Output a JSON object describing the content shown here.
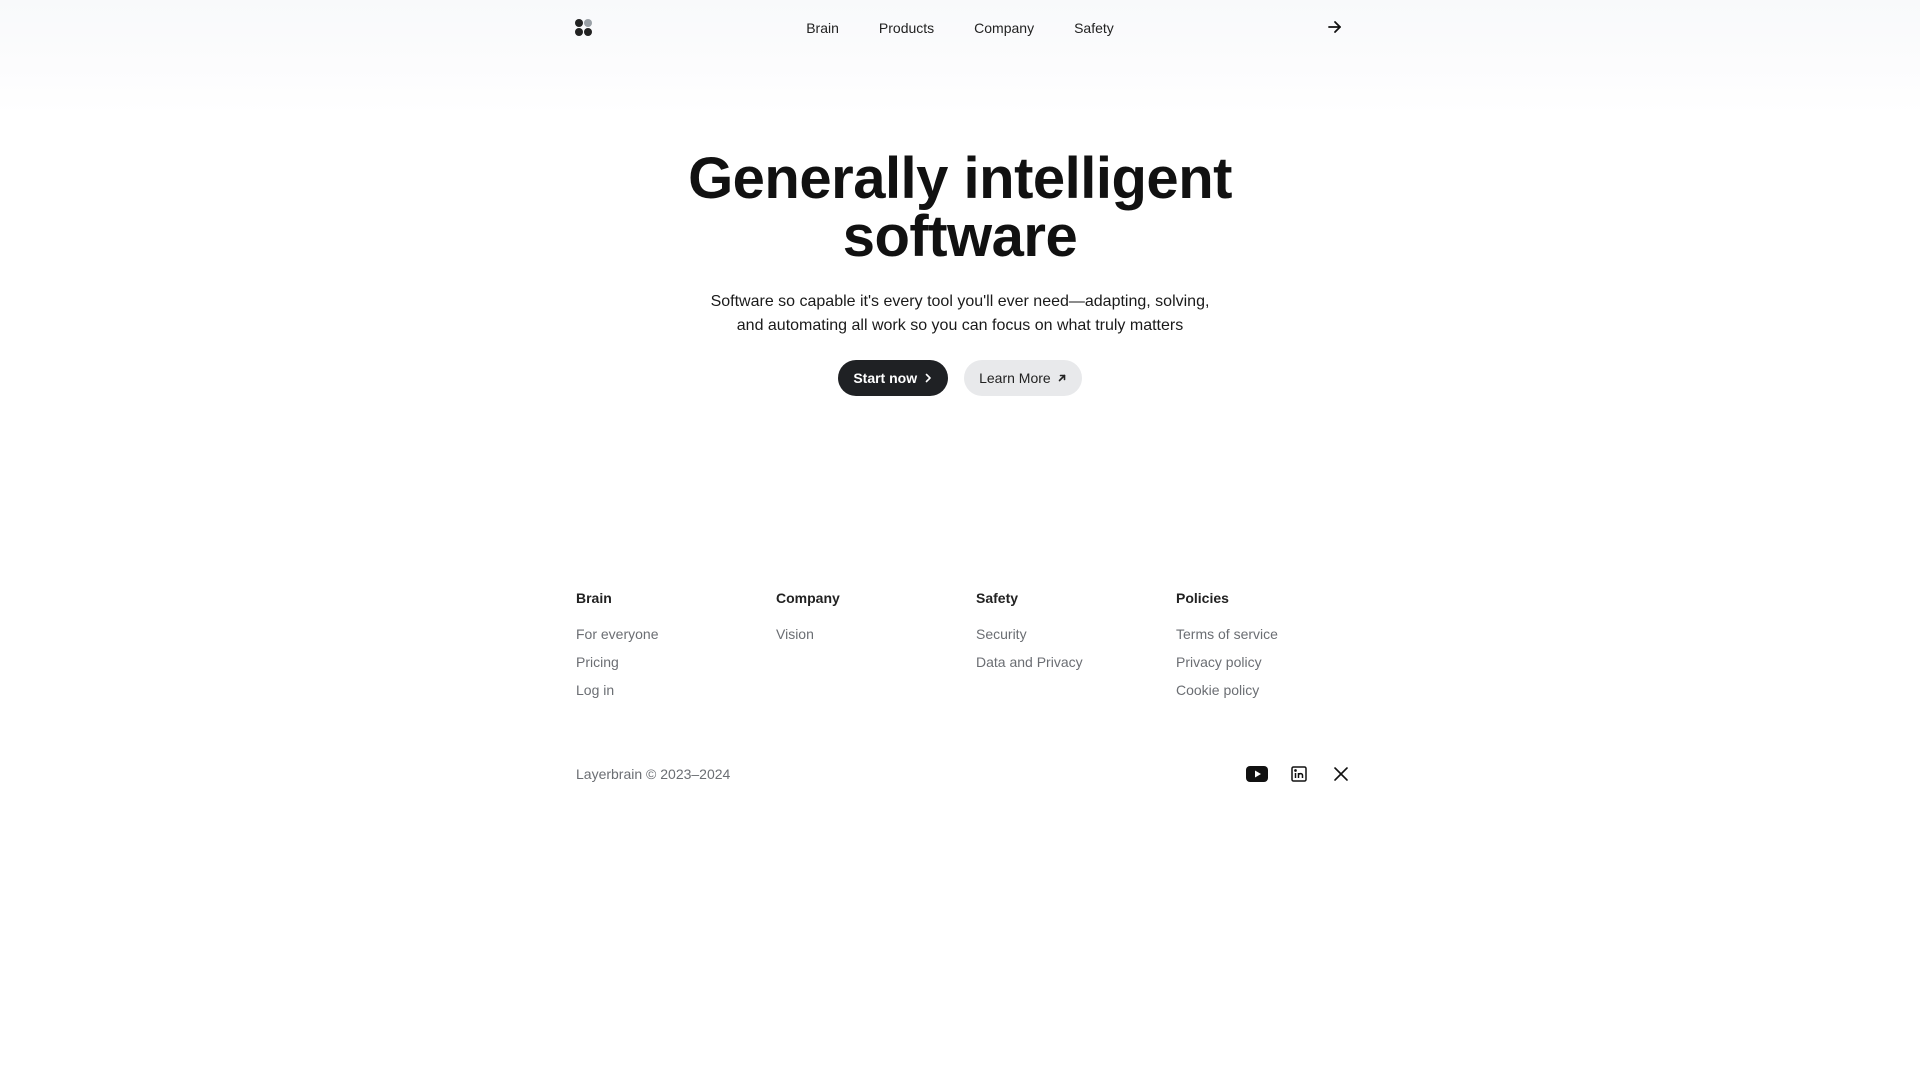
{
  "header": {
    "logo_name": "four-dot-logo",
    "nav": [
      {
        "label": "Brain"
      },
      {
        "label": "Products"
      },
      {
        "label": "Company"
      },
      {
        "label": "Safety"
      }
    ],
    "action_icon": "arrow-right-icon"
  },
  "hero": {
    "title_line1": "Generally intelligent",
    "title_line2": "software",
    "subtitle_line1": "Software so capable it's every tool you'll ever need—adapting, solving,",
    "subtitle_line2": "and automating all work so you can focus on what truly matters",
    "primary_button": "Start now",
    "secondary_button": "Learn More"
  },
  "footer": {
    "columns": [
      {
        "title": "Brain",
        "links": [
          "For everyone",
          "Pricing",
          "Log in"
        ]
      },
      {
        "title": "Company",
        "links": [
          "Vision"
        ]
      },
      {
        "title": "Safety",
        "links": [
          "Security",
          "Data and Privacy"
        ]
      },
      {
        "title": "Policies",
        "links": [
          "Terms of service",
          "Privacy policy",
          "Cookie policy"
        ]
      }
    ],
    "copyright": "Layerbrain © 2023–2024",
    "socials": [
      "youtube-icon",
      "linkedin-icon",
      "x-icon"
    ]
  },
  "colors": {
    "primary_button_bg": "#1f2124",
    "secondary_button_bg": "#e8e9eb",
    "link_gray": "#6b6e73"
  }
}
